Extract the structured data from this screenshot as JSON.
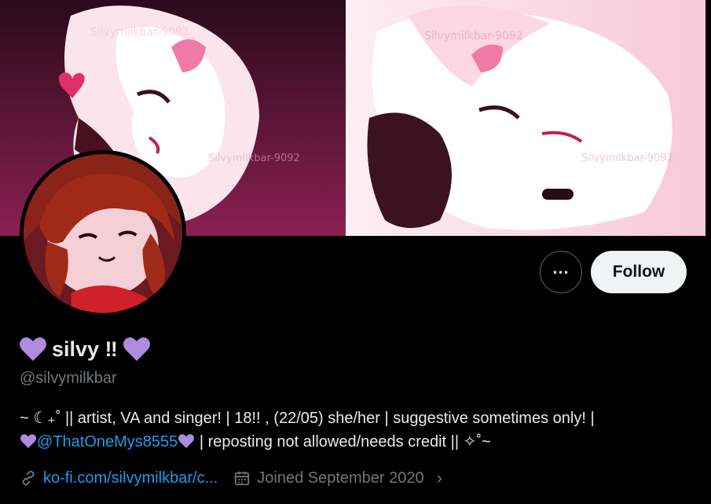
{
  "banner": {
    "watermark": "Silvymilkbar-9092"
  },
  "profile": {
    "display_name": "silvy ‼",
    "handle": "@silvymilkbar",
    "bio_line1": "~ ☾₊˚ || artist, VA and singer! | 18!! , (22/05) she/her | suggestive sometimes only! |",
    "bio_mention": "@ThatOneMys8555",
    "bio_line2_rest": " | reposting not allowed/needs credit || ✧˚~",
    "link": "ko-fi.com/silvymilkbar/c...",
    "joined": "Joined September 2020"
  },
  "actions": {
    "more_label": "...",
    "follow_label": "Follow"
  },
  "icons": {
    "heart": "purple-heart-icon",
    "link": "link-icon",
    "calendar": "calendar-icon",
    "more": "more-icon",
    "chevron": "chevron-right-icon"
  },
  "colors": {
    "background": "#000000",
    "accent": "#1d9bf0",
    "heart": "#ad8bde",
    "follow_bg": "#eff3f4"
  }
}
